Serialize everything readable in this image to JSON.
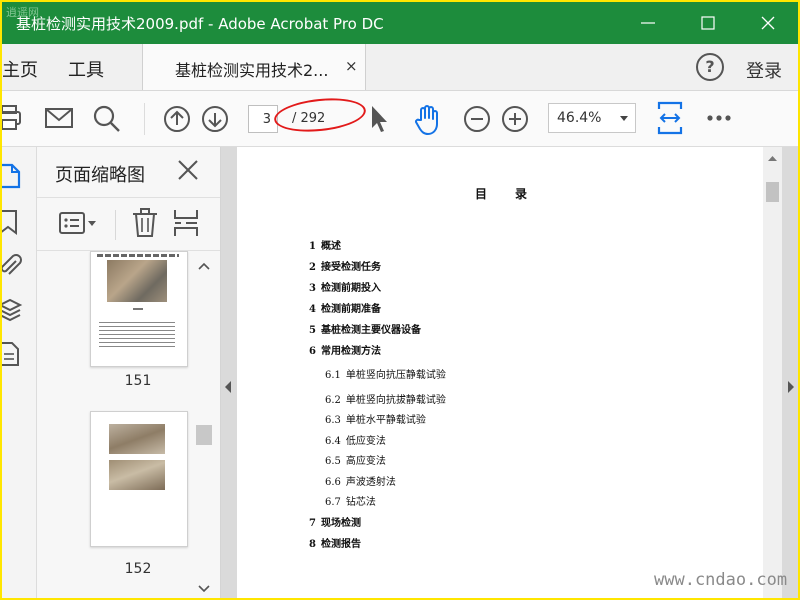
{
  "window": {
    "watermark": "逍遥网",
    "title": "基桩检测实用技术2009.pdf - Adobe Acrobat Pro DC"
  },
  "tabbar": {
    "home": "主页",
    "tools": "工具",
    "doc_tab": "基桩检测实用技术2...",
    "close_glyph": "×",
    "help_glyph": "?",
    "login": "登录"
  },
  "toolbar": {
    "current_page": "3",
    "total_pages": "/ 292",
    "zoom": "46.4%"
  },
  "panel": {
    "title": "页面缩略图",
    "thumbnails": [
      {
        "label": "151"
      },
      {
        "label": "152"
      }
    ]
  },
  "document": {
    "heading": "目录",
    "toc": [
      {
        "num": "1",
        "text": "概述",
        "level": 1
      },
      {
        "num": "2",
        "text": "接受检测任务",
        "level": 1
      },
      {
        "num": "3",
        "text": "检测前期投入",
        "level": 1
      },
      {
        "num": "4",
        "text": "检测前期准备",
        "level": 1
      },
      {
        "num": "5",
        "text": "基桩检测主要仪器设备",
        "level": 1
      },
      {
        "num": "6",
        "text": "常用检测方法",
        "level": 1
      },
      {
        "num": "6.1",
        "text": "单桩竖向抗压静载试验",
        "level": 2
      },
      {
        "num": "6.2",
        "text": "单桩竖向抗拔静载试验",
        "level": 2
      },
      {
        "num": "6.3",
        "text": "单桩水平静载试验",
        "level": 2
      },
      {
        "num": "6.4",
        "text": "低应变法",
        "level": 2
      },
      {
        "num": "6.5",
        "text": "高应变法",
        "level": 2
      },
      {
        "num": "6.6",
        "text": "声波透射法",
        "level": 2
      },
      {
        "num": "6.7",
        "text": "钻芯法",
        "level": 2
      },
      {
        "num": "7",
        "text": "现场检测",
        "level": 1
      },
      {
        "num": "8",
        "text": "检测报告",
        "level": 1
      }
    ]
  },
  "footer_watermark": "www.cndao.com",
  "colors": {
    "titlebar": "#1d8c3c",
    "accent": "#1473e6",
    "border_frame": "#ffe600",
    "annotation": "#e21a1a"
  }
}
